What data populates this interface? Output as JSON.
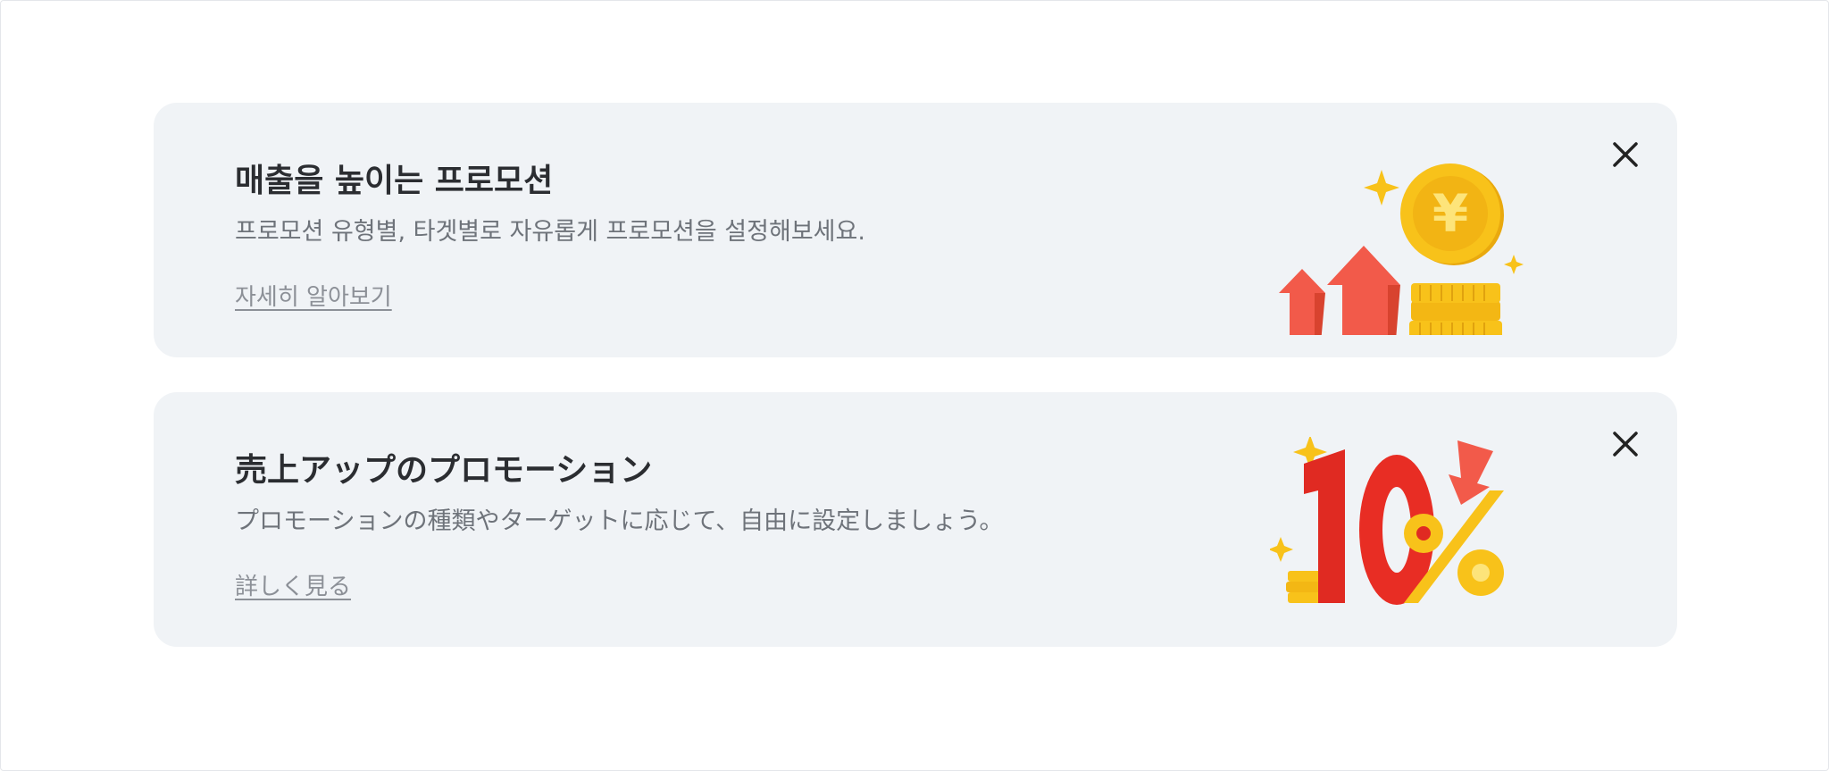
{
  "banners": [
    {
      "title": "매출을 높이는 프로모션",
      "description": "프로모션 유형별, 타겟별로 자유롭게 프로모션을 설정해보세요.",
      "link_label": "자세히 알아보기",
      "illustration_icon": "coin-growth-icon",
      "coin_symbol": "¥",
      "close_icon": "close-icon"
    },
    {
      "title": "売上アップのプロモーション",
      "description": "プロモーションの種類やターゲットに応じて、自由に設定しましょう。",
      "link_label": "詳しく見る",
      "illustration_icon": "ten-percent-discount-icon",
      "discount_text": "10%",
      "close_icon": "close-icon"
    }
  ],
  "colors": {
    "banner_bg": "#f0f3f6",
    "title": "#2b2d31",
    "description": "#6e737a",
    "link": "#8c9097",
    "arrow_red": "#f25a4a",
    "coin_gold": "#f8c21a"
  }
}
